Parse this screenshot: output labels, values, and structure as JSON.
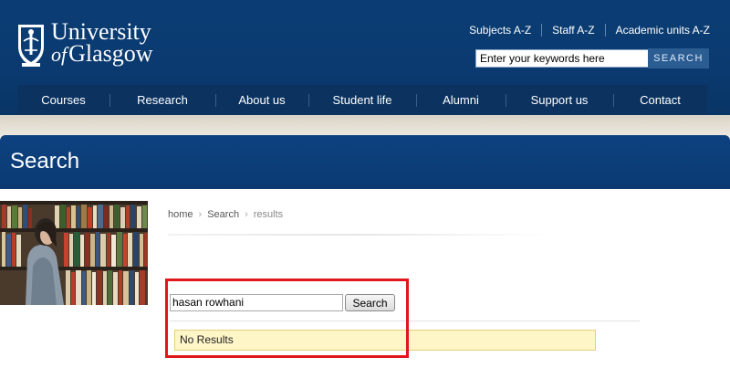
{
  "logo": {
    "line1": "University",
    "line2_of": "of",
    "line2_rest": "Glasgow"
  },
  "toplinks": [
    "Subjects A-Z",
    "Staff A-Z",
    "Academic units A-Z"
  ],
  "site_search": {
    "placeholder": "Enter your keywords here",
    "button": "SEARCH"
  },
  "nav": [
    "Courses",
    "Research",
    "About us",
    "Student life",
    "Alumni",
    "Support us",
    "Contact"
  ],
  "page_title": "Search",
  "breadcrumb": {
    "home": "home",
    "search": "Search",
    "current": "results"
  },
  "query": {
    "value": "hasan rowhani",
    "button": "Search"
  },
  "results_message": "No Results",
  "colors": {
    "header": "#0b3d74",
    "nav": "#0c3360",
    "highlight": "#e0161e",
    "notice_bg": "#fff6c8"
  }
}
